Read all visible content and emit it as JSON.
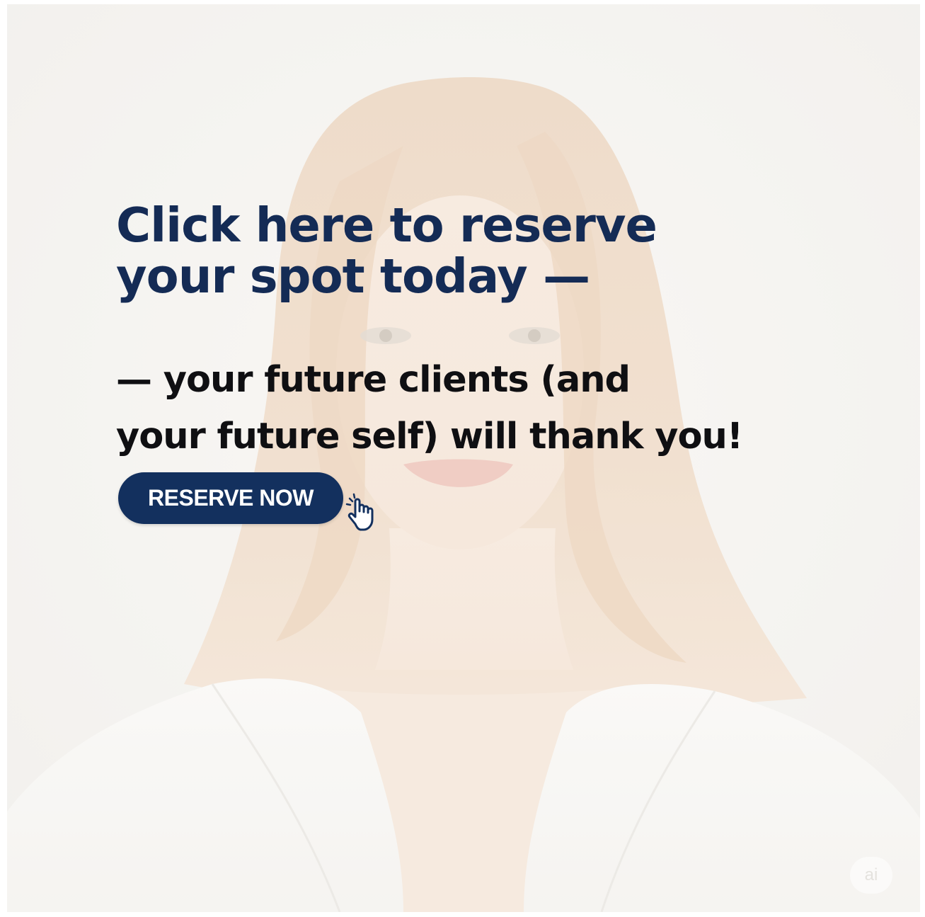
{
  "headline": {
    "line1": "Click here to reserve",
    "line2": "your spot today —"
  },
  "subline": {
    "line1": "— your future clients (and",
    "line2": "your future self) will thank you!"
  },
  "cta": {
    "label": "RESERVE NOW"
  },
  "watermark": {
    "label": "ai"
  },
  "icons": {
    "cursor": "pointer-hand-icon"
  },
  "colors": {
    "headline": "#142b55",
    "subline": "#0f0f12",
    "button": "#13305e",
    "button_text": "#ffffff",
    "background": "#f4f2ee"
  }
}
